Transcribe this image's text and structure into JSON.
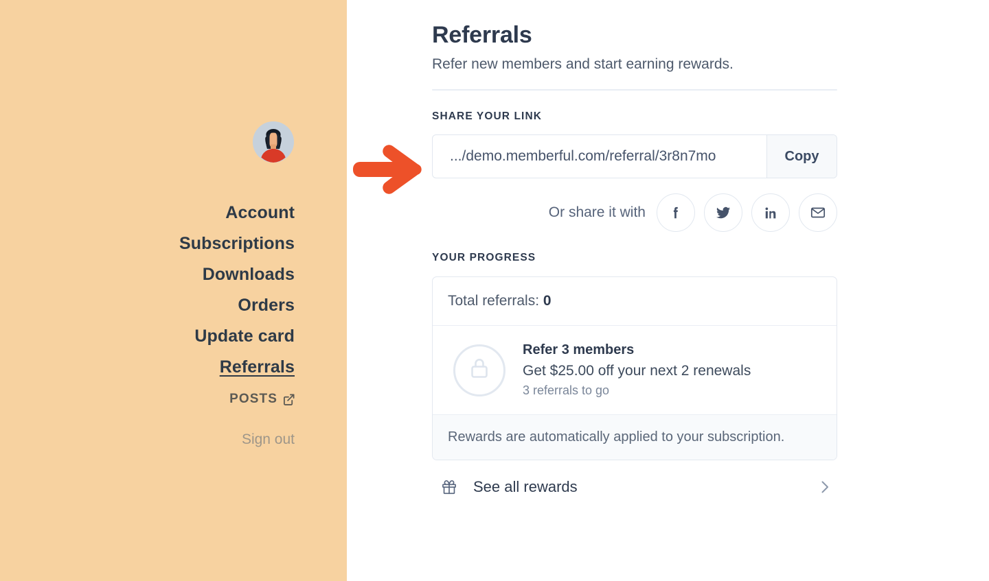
{
  "sidebar": {
    "avatar_alt": "member-avatar",
    "nav_items": [
      {
        "label": "Account",
        "active": false
      },
      {
        "label": "Subscriptions",
        "active": false
      },
      {
        "label": "Downloads",
        "active": false
      },
      {
        "label": "Orders",
        "active": false
      },
      {
        "label": "Update card",
        "active": false
      },
      {
        "label": "Referrals",
        "active": true
      }
    ],
    "posts_label": "POSTS",
    "sign_out_label": "Sign out",
    "background_color": "#F7D2A0"
  },
  "annotation": {
    "type": "arrow",
    "direction": "right",
    "color": "#ED5129"
  },
  "header": {
    "title": "Referrals",
    "subtitle": "Refer new members and start earning rewards."
  },
  "share": {
    "section_label": "SHARE YOUR LINK",
    "link_value": ".../demo.memberful.com/referral/3r8n7mo",
    "link_placeholder": "Your referral link",
    "copy_label": "Copy",
    "or_share_label": "Or share it with",
    "social": [
      {
        "name": "facebook",
        "title": "Share on Facebook"
      },
      {
        "name": "twitter",
        "title": "Share on Twitter"
      },
      {
        "name": "linkedin",
        "title": "Share on LinkedIn"
      },
      {
        "name": "email",
        "title": "Share by email"
      }
    ]
  },
  "progress": {
    "section_label": "YOUR PROGRESS",
    "total_referrals_label": "Total referrals:",
    "total_referrals_value": "0",
    "reward": {
      "locked": true,
      "title": "Refer 3 members",
      "description": "Get $25.00 off your next 2 renewals",
      "remaining": "3 referrals to go"
    },
    "note": "Rewards are automatically applied to your subscription."
  },
  "footer": {
    "see_all_rewards_label": "See all rewards"
  }
}
